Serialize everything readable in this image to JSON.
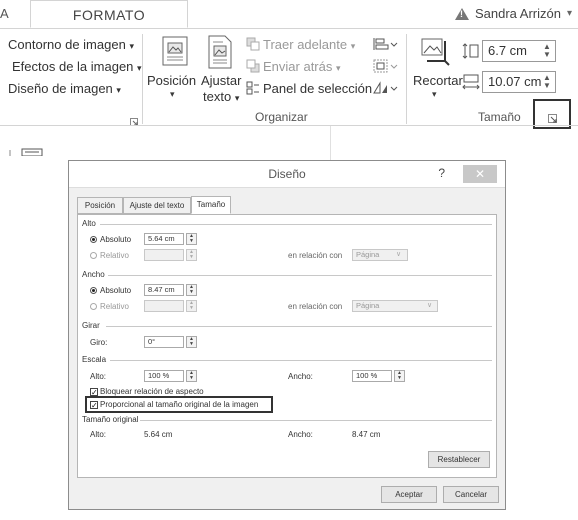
{
  "ribbon": {
    "prev_tab": "A",
    "active_tab": "FORMATO",
    "user": "Sandra Arrizón",
    "user_caret": "▾",
    "adjust": {
      "items": [
        "Contorno de imagen",
        "Efectos de la imagen",
        "Diseño de imagen"
      ],
      "caret": "▾"
    },
    "arrange": {
      "position_label": "Posición",
      "wrap_label_1": "Ajustar",
      "wrap_label_2": "texto",
      "bring_forward": "Traer adelante",
      "send_backward": "Enviar atrás",
      "selection_pane": "Panel de selección",
      "group_label": "Organizar"
    },
    "size": {
      "crop_label": "Recortar",
      "height_value": "6.7 cm",
      "width_value": "10.07 cm",
      "group_label": "Tamaño"
    }
  },
  "dialog": {
    "title": "Diseño",
    "help": "?",
    "close": "✕",
    "tabs": [
      "Posición",
      "Ajuste del texto",
      "Tamaño"
    ],
    "alto": {
      "header": "Alto",
      "absolute_label": "Absoluto",
      "absolute_value": "5.64 cm",
      "relative_label": "Relativo",
      "relative_value": "",
      "relation_label": "en relación con",
      "relation_value": "Página"
    },
    "ancho": {
      "header": "Ancho",
      "absolute_label": "Absoluto",
      "absolute_value": "8.47 cm",
      "relative_label": "Relativo",
      "relative_value": "",
      "relation_label": "en relación con",
      "relation_value": "Página"
    },
    "girar": {
      "header": "Girar",
      "rotation_label": "Giro:",
      "rotation_value": "0°"
    },
    "escala": {
      "header": "Escala",
      "alto_label": "Alto:",
      "alto_value": "100 %",
      "ancho_label": "Ancho:",
      "ancho_value": "100 %",
      "lock_aspect": "Bloquear relación de aspecto",
      "proportional": "Proporcional al tamaño original de la imagen"
    },
    "original": {
      "header": "Tamaño original",
      "alto_label": "Alto:",
      "alto_value": "5.64 cm",
      "ancho_label": "Ancho:",
      "ancho_value": "8.47 cm"
    },
    "reset": "Restablecer",
    "ok": "Aceptar",
    "cancel": "Cancelar"
  }
}
